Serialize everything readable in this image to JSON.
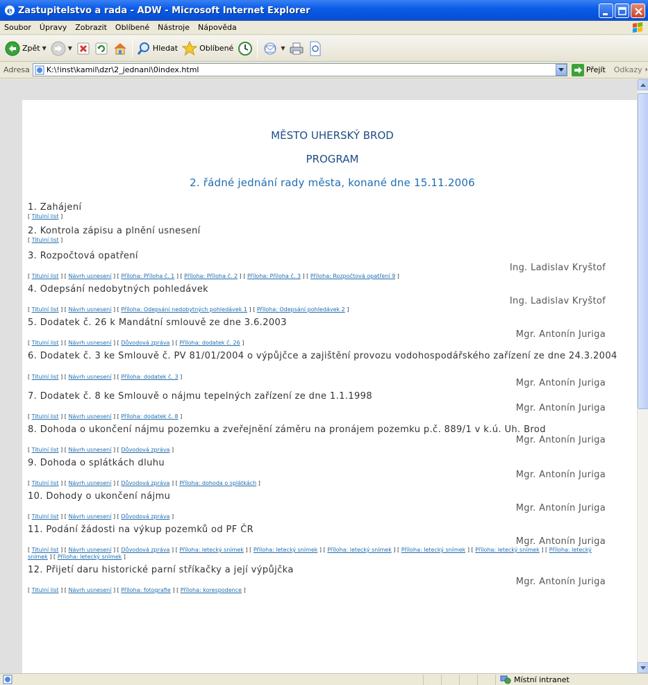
{
  "window": {
    "title": "Zastupitelstvo a rada - ADW - Microsoft Internet Explorer"
  },
  "menu": [
    "Soubor",
    "Úpravy",
    "Zobrazit",
    "Oblíbené",
    "Nástroje",
    "Nápověda"
  ],
  "toolbar": {
    "back_label": "Zpět",
    "search_label": "Hledat",
    "favorites_label": "Oblíbené"
  },
  "address": {
    "label": "Adresa",
    "value": "K:\\!inst\\kamil\\dzr\\2_jednani\\0index.html",
    "go_label": "Přejít",
    "links_label": "Odkazy"
  },
  "page": {
    "city": "MĚSTO UHERSKÝ BROD",
    "program": "PROGRAM",
    "meeting": "2. řádné jednání rady města, konané dne 15.11.2006",
    "items": [
      {
        "title": "1.   Zahájení",
        "presenter": "",
        "links": [
          "Titulní list"
        ]
      },
      {
        "title": "2.   Kontrola zápisu a plnění usnesení",
        "presenter": "",
        "links": [
          "Titulní list"
        ]
      },
      {
        "title": "3.   Rozpočtová opatření",
        "presenter": "Ing. Ladislav Kryštof",
        "links": [
          "Titulní list",
          "Návrh usnesení",
          "Příloha: Příloha č. 1",
          "Příloha: Příloha č. 2",
          "Příloha: Příloha č. 3",
          "Příloha: Rozpočtová opatření 9"
        ]
      },
      {
        "title": "4.   Odepsání nedobytných pohledávek",
        "presenter": "Ing. Ladislav Kryštof",
        "links": [
          "Titulní list",
          "Návrh usnesení",
          "Příloha: Odepsání nedobytných pohledávek 1",
          "Příloha: Odepsání pohledávek 2"
        ]
      },
      {
        "title": "5.   Dodatek č. 26 k Mandátní smlouvě ze dne 3.6.2003",
        "presenter": "Mgr. Antonín Juriga",
        "links": [
          "Titulní list",
          "Návrh usnesení",
          "Důvodová zpráva",
          "Příloha: dodatek č. 26"
        ]
      },
      {
        "title": "6.   Dodatek č. 3 ke Smlouvě č. PV 81/01/2004 o výpůjčce a zajištění provozu vodohospodářského zařízení ze dne 24.3.2004",
        "presenter": "Mgr. Antonín Juriga",
        "links": [
          "Titulní list",
          "Návrh usnesení",
          "Příloha: dodatek č. 3"
        ]
      },
      {
        "title": "7.   Dodatek č. 8 ke Smlouvě o nájmu tepelných zařízení ze dne 1.1.1998",
        "presenter": "Mgr. Antonín Juriga",
        "links": [
          "Titulní list",
          "Návrh usnesení",
          "Příloha: dodatek č. 8"
        ]
      },
      {
        "title": "8.   Dohoda o ukončení nájmu pozemku a zveřejnění záměru na pronájem pozemku p.č. 889/1 v k.ú. Uh. Brod",
        "presenter": "Mgr. Antonín Juriga",
        "links": [
          "Titulní list",
          "Návrh usnesení",
          "Důvodová zpráva"
        ]
      },
      {
        "title": "9.   Dohoda o splátkách dluhu",
        "presenter": "Mgr. Antonín Juriga",
        "links": [
          "Titulní list",
          "Návrh usnesení",
          "Důvodová zpráva",
          "Příloha: dohoda o splátkách"
        ]
      },
      {
        "title": "10.   Dohody o ukončení nájmu",
        "presenter": "Mgr. Antonín Juriga",
        "links": [
          "Titulní list",
          "Návrh usnesení",
          "Důvodová zpráva"
        ]
      },
      {
        "title": "11.   Podání žádosti na výkup pozemků od PF ČR",
        "presenter": "Mgr. Antonín Juriga",
        "links": [
          "Titulní list",
          "Návrh usnesení",
          "Důvodová zpráva",
          "Příloha: letecký snímek",
          "Příloha: letecký snímek",
          "Příloha: letecký snímek",
          "Příloha: letecký snímek",
          "Příloha: letecký snímek",
          "Příloha: letecký snímek",
          "Příloha: letecký snímek"
        ]
      },
      {
        "title": "12.   Přijetí daru historické parní stříkačky a její výpůjčka",
        "presenter": "Mgr. Antonín Juriga",
        "links": [
          "Titulní list",
          "Návrh usnesení",
          "Příloha: fotografie",
          "Příloha: korespodence"
        ]
      }
    ]
  },
  "status": {
    "zone": "Místní intranet"
  }
}
